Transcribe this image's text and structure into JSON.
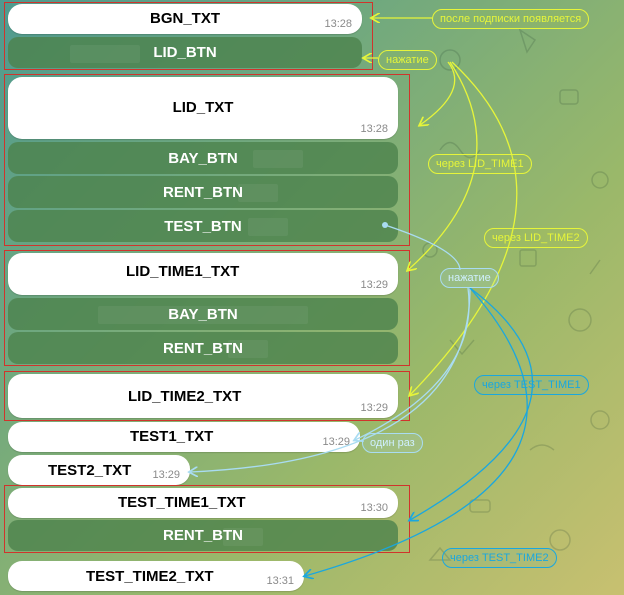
{
  "messages": {
    "bgn_txt": {
      "text": "BGN_TXT",
      "time": "13:28"
    },
    "lid_txt": {
      "text": "LID_TXT",
      "time": "13:28"
    },
    "lid_time1_txt": {
      "text": "LID_TIME1_TXT",
      "time": "13:29"
    },
    "lid_time2_txt": {
      "text": "LID_TIME2_TXT",
      "time": "13:29"
    },
    "test1_txt": {
      "text": "TEST1_TXT",
      "time": "13:29"
    },
    "test2_txt": {
      "text": "TEST2_TXT",
      "time": "13:29"
    },
    "test_time1_txt": {
      "text": "TEST_TIME1_TXT",
      "time": "13:30"
    },
    "test_time2_txt": {
      "text": "TEST_TIME2_TXT",
      "time": "13:31"
    }
  },
  "buttons": {
    "lid_btn": "LID_BTN",
    "bay_btn_1": "BAY_BTN",
    "rent_btn_1": "RENT_BTN",
    "test_btn": "TEST_BTN",
    "bay_btn_2": "BAY_BTN",
    "rent_btn_2": "RENT_BTN",
    "rent_btn_3": "RENT_BTN"
  },
  "annotations": {
    "after_subscribe": "после подписки появляется",
    "press_1": "нажатие",
    "via_lid_time1": "через LID_TIME1",
    "via_lid_time2": "через LID_TIME2",
    "press_2": "нажатие",
    "via_test_time1": "через TEST_TIME1",
    "once": "один раз",
    "via_test_time2": "через TEST_TIME2"
  },
  "colors": {
    "frame": "#d0342c",
    "annotation_yellow": "#e6f53a",
    "annotation_light_blue": "#a9dcf2",
    "annotation_blue": "#1aa7df",
    "button": "#4c824c"
  }
}
